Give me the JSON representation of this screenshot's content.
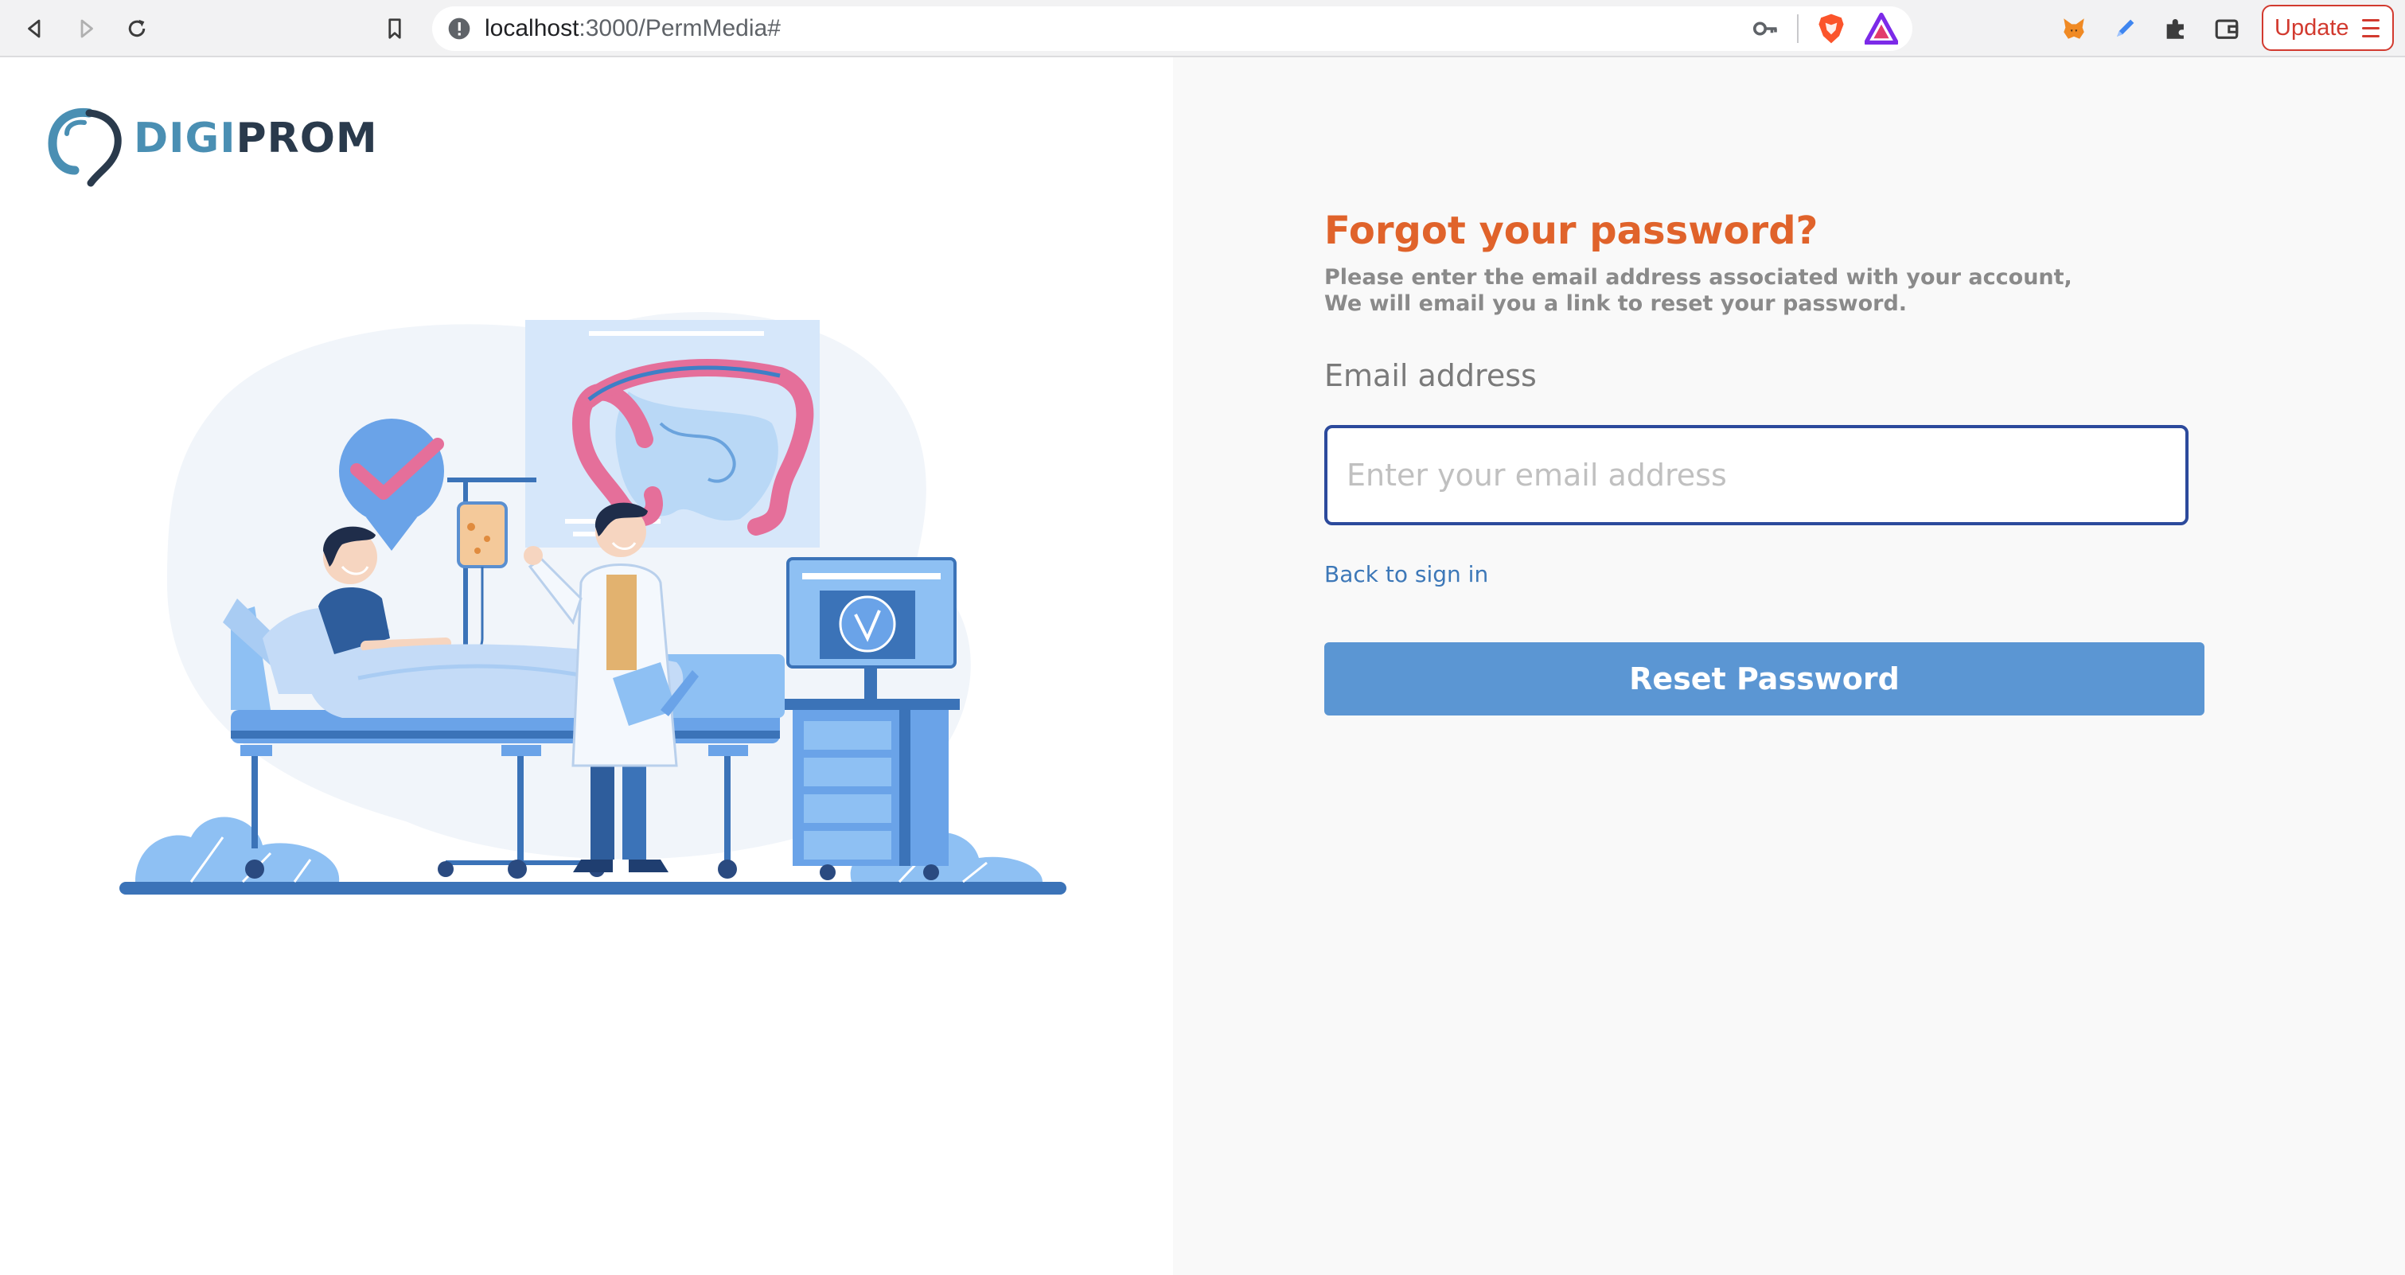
{
  "browser": {
    "url_host": "localhost",
    "url_path": ":3000/PermMedia#",
    "update_label": "Update"
  },
  "brand": {
    "logo_part1": "DIGI",
    "logo_part2": "PROM",
    "accent_color": "#e0632b",
    "button_color": "#5b96d3",
    "input_border_color": "#2c4a9c"
  },
  "form": {
    "title": "Forgot your password?",
    "subtitle_line1": "Please enter the email address associated with your account,",
    "subtitle_line2": "We will email you a link to reset your password.",
    "email_label": "Email address",
    "email_placeholder": "Enter your email address",
    "email_value": "",
    "back_link": "Back to sign in",
    "submit_label": "Reset Password"
  },
  "icons": {
    "nav": [
      "back-arrow-icon",
      "forward-arrow-icon",
      "reload-icon",
      "bookmark-icon"
    ],
    "omnibox": [
      "info-icon",
      "key-icon",
      "brave-shield-icon",
      "brave-rewards-icon"
    ],
    "extensions": [
      "metamask-fox-icon",
      "pen-extension-icon",
      "puzzle-extensions-icon",
      "wallet-icon"
    ]
  }
}
